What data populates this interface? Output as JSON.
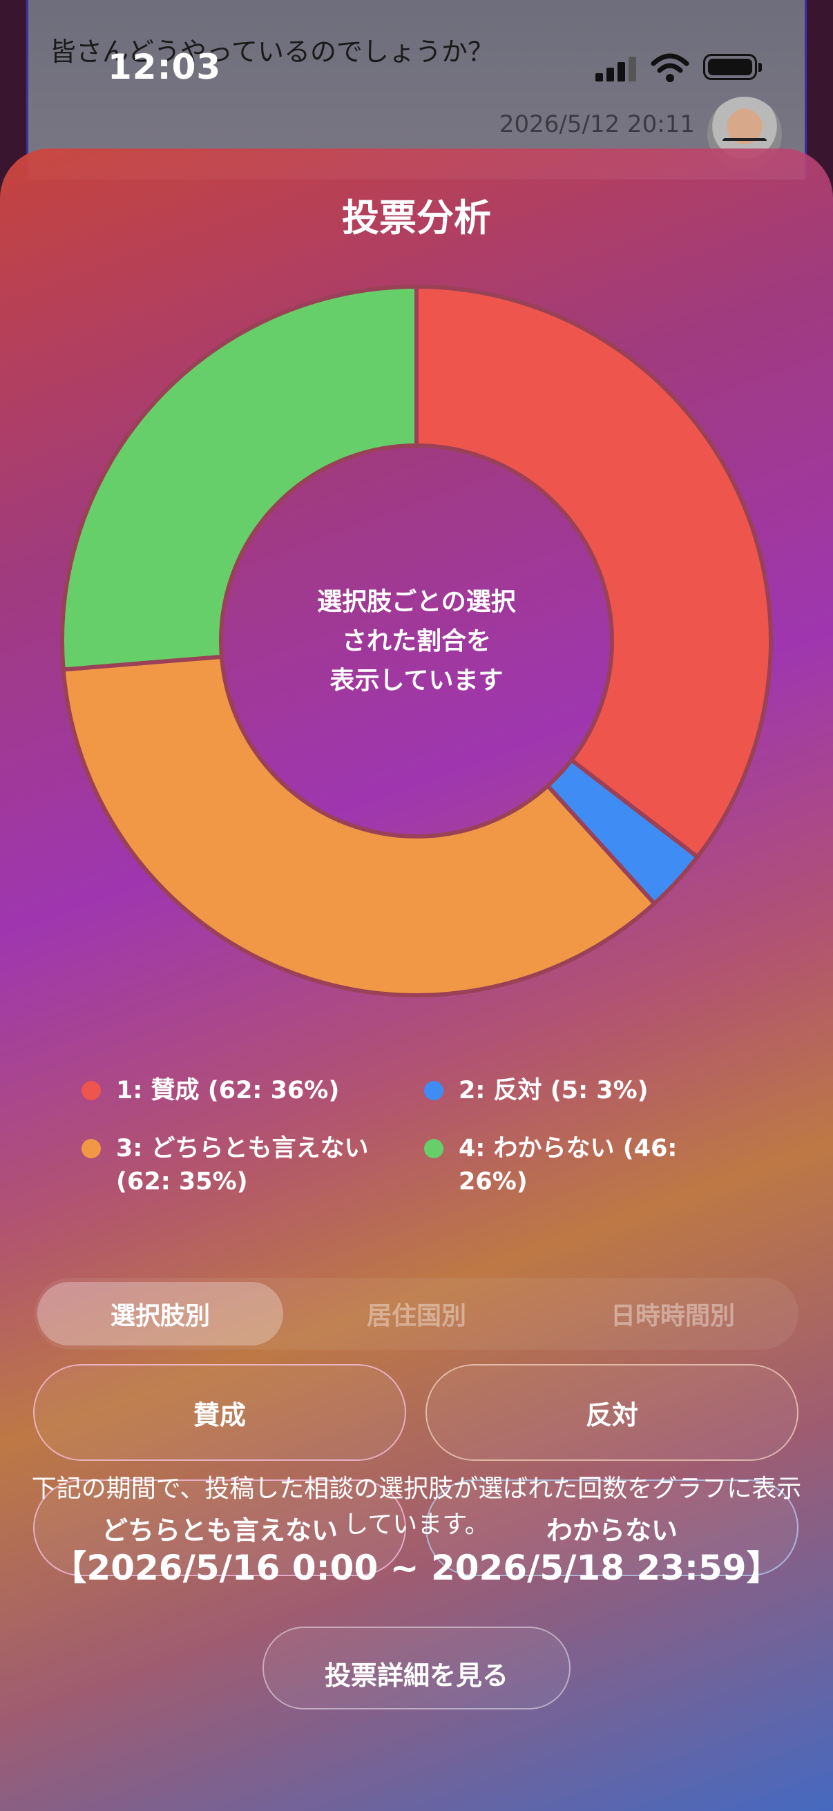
{
  "background_post": {
    "title": "皆さんどうやっているのでしょうか？",
    "timestamp": "2026/5/12 20:11"
  },
  "status_bar": {
    "time": "12:03"
  },
  "sheet": {
    "title": "投票分析",
    "center_text": [
      "選択肢ごとの選択",
      "された割合を",
      "表示しています"
    ],
    "tabs": [
      {
        "label": "選択肢別",
        "active": true
      },
      {
        "label": "居住国別",
        "active": false
      },
      {
        "label": "日時時間別",
        "active": false
      }
    ],
    "choices": [
      "賛成",
      "反対",
      "どちらとも言えない",
      "わからない"
    ],
    "note": "下記の期間で、投稿した相談の選択肢が選ばれた回数をグラフに表示しています。",
    "period": "【2026/5/16 0:00 ~ 2026/5/18 23:59】",
    "detail_button": "投票詳細を見る"
  },
  "legend": [
    {
      "label": "1: 賛成 (62: 36%)",
      "color": "#ee554d"
    },
    {
      "label": "2: 反対 (5: 3%)",
      "color": "#3f8cf4"
    },
    {
      "label": "3: どちらとも言えない (62: 35%)",
      "color": "#f19847"
    },
    {
      "label": "4: わからない (46: 26%)",
      "color": "#67cf6a"
    }
  ],
  "chart_data": {
    "type": "pie",
    "donut": true,
    "categories": [
      "1: 賛成",
      "2: 反対",
      "3: どちらとも言えない",
      "4: わからない"
    ],
    "values": [
      62,
      5,
      62,
      46
    ],
    "percents": [
      36,
      3,
      35,
      26
    ],
    "colors": [
      "#ee554d",
      "#3f8cf4",
      "#f19847",
      "#67cf6a"
    ]
  }
}
